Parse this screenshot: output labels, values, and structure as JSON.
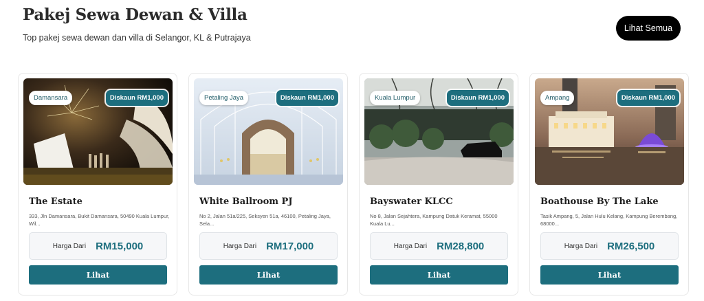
{
  "header": {
    "title": "Pakej Sewa Dewan & Villa",
    "subtitle": "Top pakej sewa dewan dan villa di Selangor, KL & Putrajaya",
    "see_all_label": "Lihat Semua"
  },
  "colors": {
    "accent": "#1d6e7e",
    "button_dark": "#000000"
  },
  "cards": [
    {
      "location": "Damansara",
      "discount": "Diskaun RM1,000",
      "name": "The Estate",
      "address": "333, Jln Damansara, Bukit Damansara, 50490 Kuala Lumpur, Wil...",
      "price_label": "Harga Dari",
      "price": "RM15,000",
      "button_label": "Lihat"
    },
    {
      "location": "Petaling Jaya",
      "discount": "Diskaun RM1,000",
      "name": "White Ballroom PJ",
      "address": "No 2, Jalan 51a/225, Seksyen 51a, 46100, Petaling Jaya, Sela...",
      "price_label": "Harga Dari",
      "price": "RM17,000",
      "button_label": "Lihat"
    },
    {
      "location": "Kuala Lumpur",
      "discount": "Diskaun RM1,000",
      "name": "Bayswater KLCC",
      "address": "No 8, Jalan Sejahtera, Kampung Datuk Keramat, 55000 Kuala Lu...",
      "price_label": "Harga Dari",
      "price": "RM28,800",
      "button_label": "Lihat"
    },
    {
      "location": "Ampang",
      "discount": "Diskaun RM1,000",
      "name": "Boathouse By The Lake",
      "address": "Tasik Ampang, 5, Jalan Hulu Kelang, Kampung Berembang, 68000...",
      "price_label": "Harga Dari",
      "price": "RM26,500",
      "button_label": "Lihat"
    }
  ]
}
